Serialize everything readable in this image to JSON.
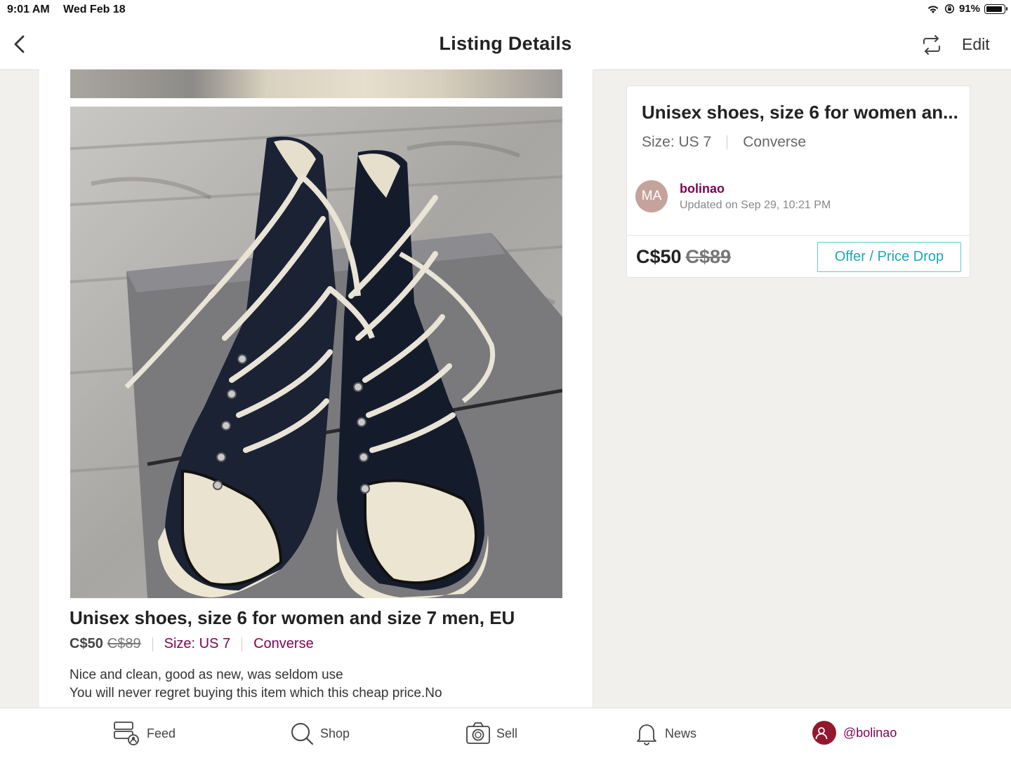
{
  "status_bar": {
    "time": "9:01 AM",
    "date": "Wed Feb 18",
    "battery": "91%"
  },
  "nav": {
    "title": "Listing Details",
    "edit_label": "Edit",
    "icons": {
      "back": "chevron-left-icon",
      "share": "share-repeat-icon"
    }
  },
  "listing": {
    "title": "Unisex shoes, size 6 for women and size 7 men, EU",
    "price": "C$50",
    "original_price": "C$89",
    "size": "Size: US 7",
    "brand": "Converse",
    "description_line1": "Nice and clean, good as new, was seldom use",
    "description_line2": "You will never regret buying this item which this cheap price.No"
  },
  "card": {
    "title": "Unisex shoes, size 6 for women an...",
    "size": "Size: US 7",
    "brand": "Converse",
    "seller_initials": "MA",
    "seller_name": "bolinao",
    "updated": "Updated on Sep 29, 10:21 PM",
    "price": "C$50",
    "original_price": "C$89",
    "offer_button": "Offer / Price Drop"
  },
  "tabs": [
    {
      "label": "Feed",
      "icon": "feed-icon"
    },
    {
      "label": "Shop",
      "icon": "search-icon"
    },
    {
      "label": "Sell",
      "icon": "camera-icon"
    },
    {
      "label": "News",
      "icon": "bell-icon"
    },
    {
      "label": "@bolinao",
      "icon": "profile-icon"
    }
  ],
  "colors": {
    "accent": "#7f0353",
    "offer_button": "#1fa5b8",
    "avatar": "#c5a29b",
    "profile_dot": "#93172d"
  }
}
